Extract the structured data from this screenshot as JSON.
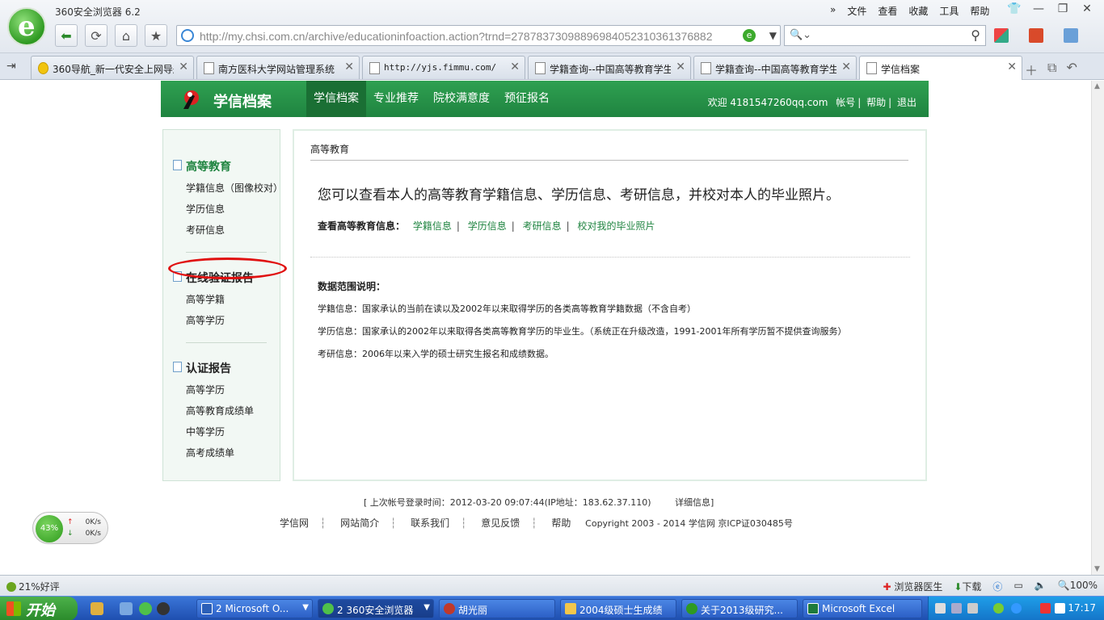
{
  "browser": {
    "title": "360安全浏览器 6.2",
    "address": "http://my.chsi.com.cn/archive/educationinfoaction.action?trnd=27878373098896984052310361376882",
    "menu": [
      "文件",
      "查看",
      "收藏",
      "工具",
      "帮助"
    ],
    "search_placeholder": "Q",
    "tabs": [
      {
        "label": "360导航_新一代安全上网导航"
      },
      {
        "label": "南方医科大学网站管理系统"
      },
      {
        "label": "http://yjs.fimmu.com/"
      },
      {
        "label": "学籍查询--中国高等教育学生"
      },
      {
        "label": "学籍查询--中国高等教育学生"
      },
      {
        "label": "学信档案"
      }
    ]
  },
  "site": {
    "name": "学信档案",
    "nav": [
      "学信档案",
      "专业推荐",
      "院校满意度",
      "预征报名"
    ],
    "user": {
      "welcome": "欢迎 4181547260qq.com",
      "account": "帐号",
      "help": "帮助",
      "logout": "退出"
    }
  },
  "sidebar": {
    "sections": [
      {
        "title": "高等教育",
        "links": [
          "学籍信息（图像校对）",
          "学历信息",
          "考研信息"
        ]
      },
      {
        "title": "在线验证报告",
        "links": [
          "高等学籍",
          "高等学历"
        ]
      },
      {
        "title": "认证报告",
        "links": [
          "高等学历",
          "高等教育成绩单",
          "中等学历",
          "高考成绩单"
        ]
      }
    ]
  },
  "main": {
    "title": "高等教育",
    "lead": "您可以查看本人的高等教育学籍信息、学历信息、考研信息，并校对本人的毕业照片。",
    "links_label": "查看高等教育信息：",
    "links": [
      "学籍信息",
      "学历信息",
      "考研信息",
      "校对我的毕业照片"
    ],
    "range_title": "数据范围说明：",
    "range_rows": [
      "学籍信息：国家承认的当前在读以及2002年以来取得学历的各类高等教育学籍数据（不含自考）",
      "学历信息：国家承认的2002年以来取得各类高等教育学历的毕业生。（系统正在升级改造，1991-2001年所有学历暂不提供查询服务）",
      "考研信息：2006年以来入学的硕士研究生报名和成绩数据。"
    ]
  },
  "footer": {
    "login": "[ 上次帐号登录时间：2012-03-20 09:07:44(IP地址：183.62.37.110)",
    "detail": "详细信息]",
    "links": [
      "学信网",
      "网站简介",
      "联系我们",
      "意见反馈",
      "帮助"
    ],
    "copyright": "Copyright 2003 - 2014 学信网 京ICP证030485号"
  },
  "speed": {
    "percent": "43%",
    "up": "0K/s",
    "down": "0K/s"
  },
  "statusbar": {
    "left": "21%好评",
    "doctor": "浏览器医生",
    "download": "下载",
    "zoom": "100%"
  },
  "taskbar": {
    "start": "开始",
    "tasks": [
      "2 Microsoft O...",
      "2 360安全浏览器",
      "胡光丽",
      "2004级硕士生成绩",
      "关于2013级研究...",
      "Microsoft Excel"
    ],
    "clock": "17:17"
  },
  "colors": {
    "green": "#1f8440",
    "highlight_red": "#e01010"
  }
}
